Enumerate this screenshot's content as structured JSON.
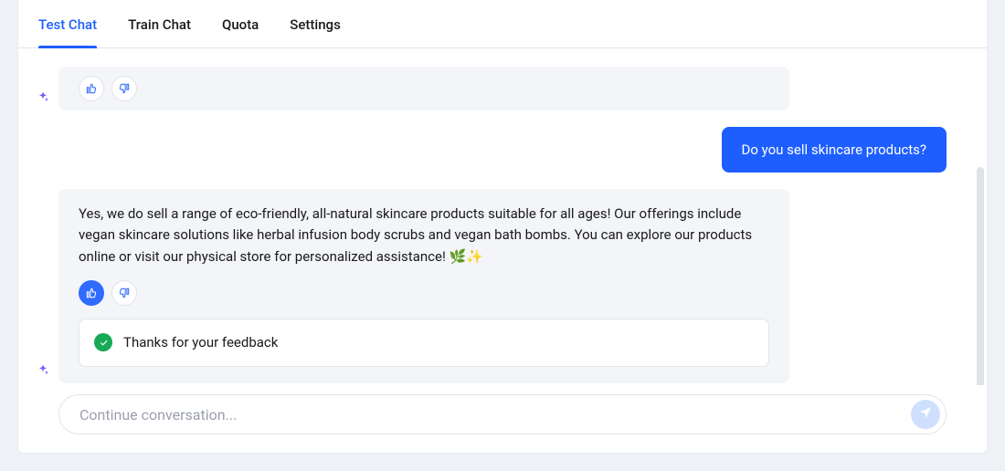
{
  "tabs": {
    "items": [
      {
        "label": "Test Chat",
        "active": true
      },
      {
        "label": "Train Chat",
        "active": false
      },
      {
        "label": "Quota",
        "active": false
      },
      {
        "label": "Settings",
        "active": false
      }
    ]
  },
  "messages": {
    "bot1_suffix": "",
    "user1": "Do you sell skincare products?",
    "bot2": "Yes, we do sell a range of eco-friendly, all-natural skincare products suitable for all ages! Our offerings include vegan skincare solutions like herbal infusion body scrubs and vegan bath bombs. You can explore our products online or visit our physical store for personalized assistance! 🌿✨"
  },
  "feedback": {
    "bot2_thumbs_up_selected": true,
    "toast_text": "Thanks for your feedback"
  },
  "composer": {
    "placeholder": "Continue conversation..."
  },
  "colors": {
    "accent": "#1e5eff",
    "success": "#18a957"
  }
}
